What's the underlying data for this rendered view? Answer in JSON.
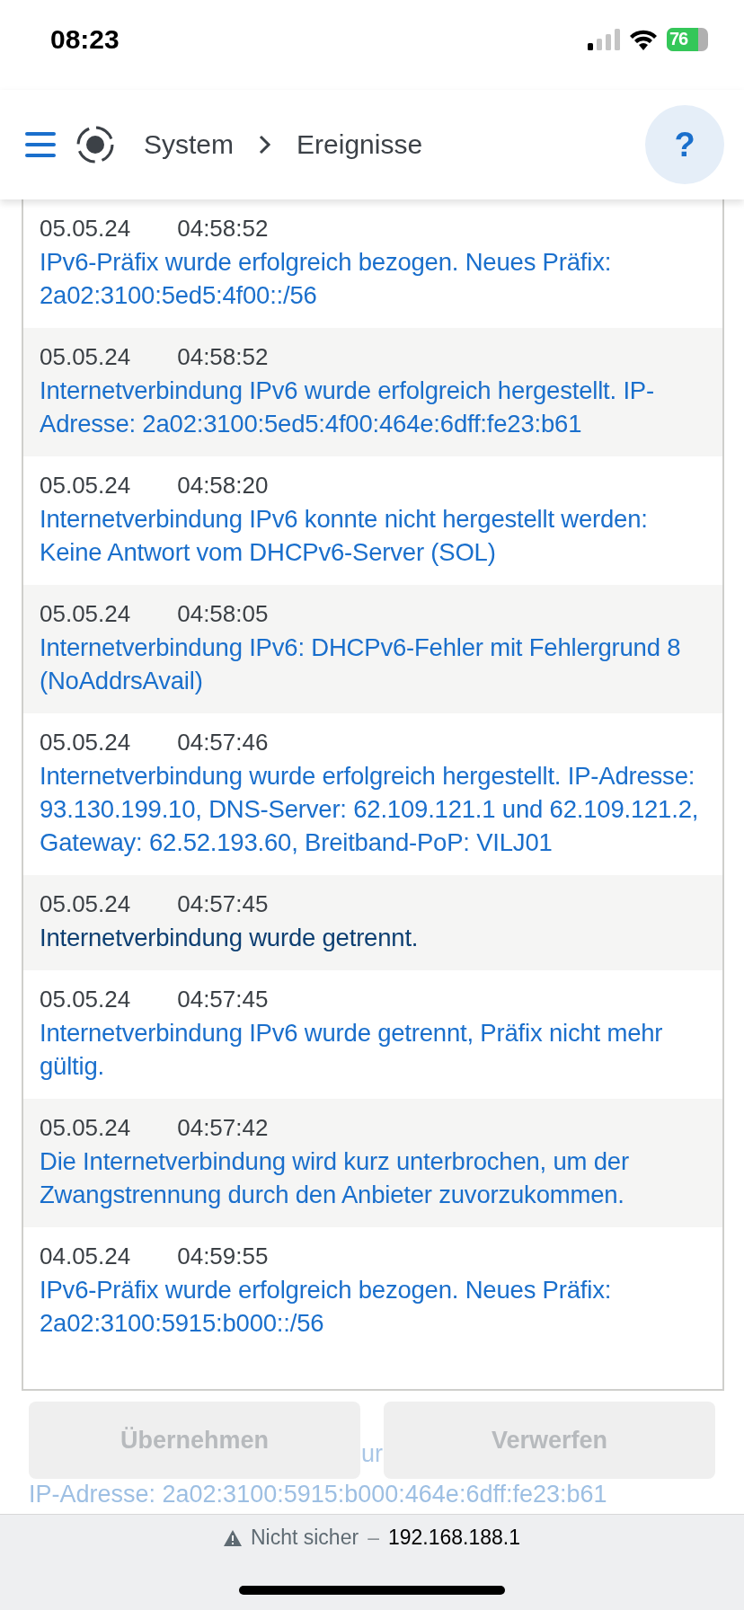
{
  "status_bar": {
    "time": "08:23",
    "battery": "76"
  },
  "header": {
    "breadcrumb": [
      "System",
      "Ereignisse"
    ],
    "help": "?"
  },
  "events": [
    {
      "date": "05.05.24",
      "time": "04:58:52",
      "message": "IPv6-Präfix wurde erfolgreich bezogen. Neues Präfix: 2a02:3100:5ed5:4f00::/56",
      "kind": "link"
    },
    {
      "date": "05.05.24",
      "time": "04:58:52",
      "message": "Internetverbindung IPv6 wurde erfolgreich hergestellt. IP-Adresse: 2a02:3100:5ed5:4f00:464e:6dff:fe23:b61",
      "kind": "link"
    },
    {
      "date": "05.05.24",
      "time": "04:58:20",
      "message": "Internetverbindung IPv6 konnte nicht hergestellt werden: Keine Antwort vom DHCPv6-Server (SOL)",
      "kind": "link"
    },
    {
      "date": "05.05.24",
      "time": "04:58:05",
      "message": "Internetverbindung IPv6: DHCPv6-Fehler mit Fehlergrund 8 (NoAddrsAvail)",
      "kind": "link"
    },
    {
      "date": "05.05.24",
      "time": "04:57:46",
      "message": "Internetverbindung wurde erfolgreich hergestellt. IP-Adresse: 93.130.199.10, DNS-Server: 62.109.121.1 und 62.109.121.2, Gateway: 62.52.193.60, Breitband-PoP: VILJ01",
      "kind": "link"
    },
    {
      "date": "05.05.24",
      "time": "04:57:45",
      "message": "Internetverbindung wurde getrennt.",
      "kind": "plain"
    },
    {
      "date": "05.05.24",
      "time": "04:57:45",
      "message": "Internetverbindung IPv6 wurde getrennt, Präfix nicht mehr gültig.",
      "kind": "link"
    },
    {
      "date": "05.05.24",
      "time": "04:57:42",
      "message": "Die Internetverbindung wird kurz unterbrochen, um der Zwangstrennung durch den Anbieter zuvorzukommen.",
      "kind": "link"
    },
    {
      "date": "04.05.24",
      "time": "04:59:55",
      "message": "IPv6-Präfix wurde erfolgreich bezogen. Neues Präfix: 2a02:3100:5915:b000::/56",
      "kind": "link"
    }
  ],
  "faded_event": {
    "fragment": "ur",
    "message": "IP-Adresse: 2a02:3100:5915:b000:464e:6dff:fe23:b61"
  },
  "buttons": [
    {
      "label": "Übernehmen",
      "disabled": true
    },
    {
      "label": "Verwerfen",
      "disabled": true
    }
  ],
  "browser_bar": {
    "security": "Nicht sicher",
    "separator": "–",
    "address": "192.168.188.1"
  }
}
